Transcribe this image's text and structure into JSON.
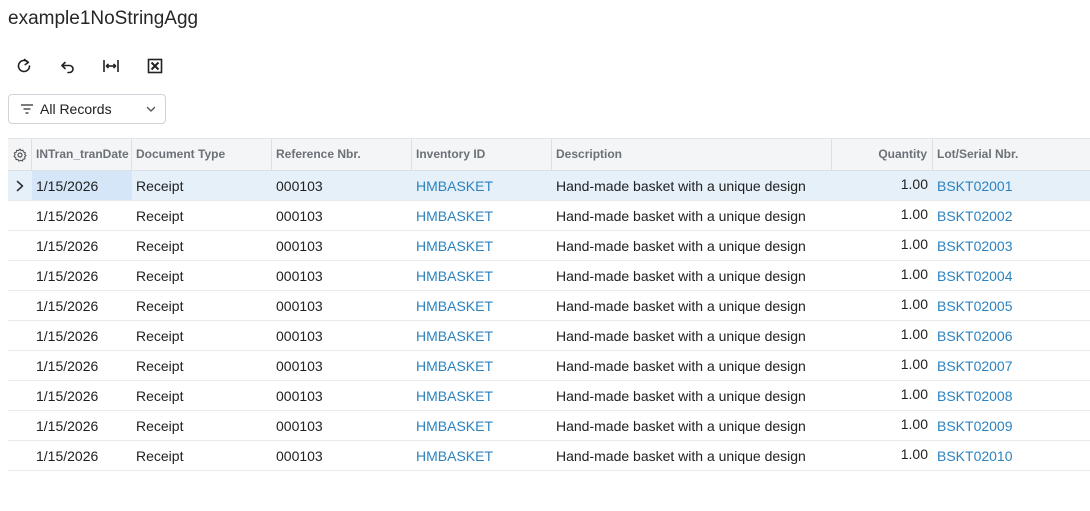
{
  "page": {
    "title": "example1NoStringAgg"
  },
  "toolbar": {
    "buttons": [
      {
        "icon": "refresh-icon"
      },
      {
        "icon": "undo-icon"
      },
      {
        "icon": "fit-to-screen-icon"
      },
      {
        "icon": "excel-export-icon"
      }
    ]
  },
  "filter": {
    "selected": "All Records"
  },
  "grid": {
    "columns": [
      "INTran_tranDate",
      "Document Type",
      "Reference Nbr.",
      "Inventory ID",
      "Description",
      "Quantity",
      "Lot/Serial Nbr."
    ],
    "rows": [
      {
        "date": "1/15/2026",
        "doc_type": "Receipt",
        "ref": "000103",
        "inventory": "HMBASKET",
        "description": "Hand-made basket with a unique design",
        "qty": "1.00",
        "lot": "BSKT02001"
      },
      {
        "date": "1/15/2026",
        "doc_type": "Receipt",
        "ref": "000103",
        "inventory": "HMBASKET",
        "description": "Hand-made basket with a unique design",
        "qty": "1.00",
        "lot": "BSKT02002"
      },
      {
        "date": "1/15/2026",
        "doc_type": "Receipt",
        "ref": "000103",
        "inventory": "HMBASKET",
        "description": "Hand-made basket with a unique design",
        "qty": "1.00",
        "lot": "BSKT02003"
      },
      {
        "date": "1/15/2026",
        "doc_type": "Receipt",
        "ref": "000103",
        "inventory": "HMBASKET",
        "description": "Hand-made basket with a unique design",
        "qty": "1.00",
        "lot": "BSKT02004"
      },
      {
        "date": "1/15/2026",
        "doc_type": "Receipt",
        "ref": "000103",
        "inventory": "HMBASKET",
        "description": "Hand-made basket with a unique design",
        "qty": "1.00",
        "lot": "BSKT02005"
      },
      {
        "date": "1/15/2026",
        "doc_type": "Receipt",
        "ref": "000103",
        "inventory": "HMBASKET",
        "description": "Hand-made basket with a unique design",
        "qty": "1.00",
        "lot": "BSKT02006"
      },
      {
        "date": "1/15/2026",
        "doc_type": "Receipt",
        "ref": "000103",
        "inventory": "HMBASKET",
        "description": "Hand-made basket with a unique design",
        "qty": "1.00",
        "lot": "BSKT02007"
      },
      {
        "date": "1/15/2026",
        "doc_type": "Receipt",
        "ref": "000103",
        "inventory": "HMBASKET",
        "description": "Hand-made basket with a unique design",
        "qty": "1.00",
        "lot": "BSKT02008"
      },
      {
        "date": "1/15/2026",
        "doc_type": "Receipt",
        "ref": "000103",
        "inventory": "HMBASKET",
        "description": "Hand-made basket with a unique design",
        "qty": "1.00",
        "lot": "BSKT02009"
      },
      {
        "date": "1/15/2026",
        "doc_type": "Receipt",
        "ref": "000103",
        "inventory": "HMBASKET",
        "description": "Hand-made basket with a unique design",
        "qty": "1.00",
        "lot": "BSKT02010"
      }
    ]
  },
  "colors": {
    "link": "#2b82bf",
    "active_row": "#e5f0f9",
    "header_bg": "#f4f5f6"
  }
}
